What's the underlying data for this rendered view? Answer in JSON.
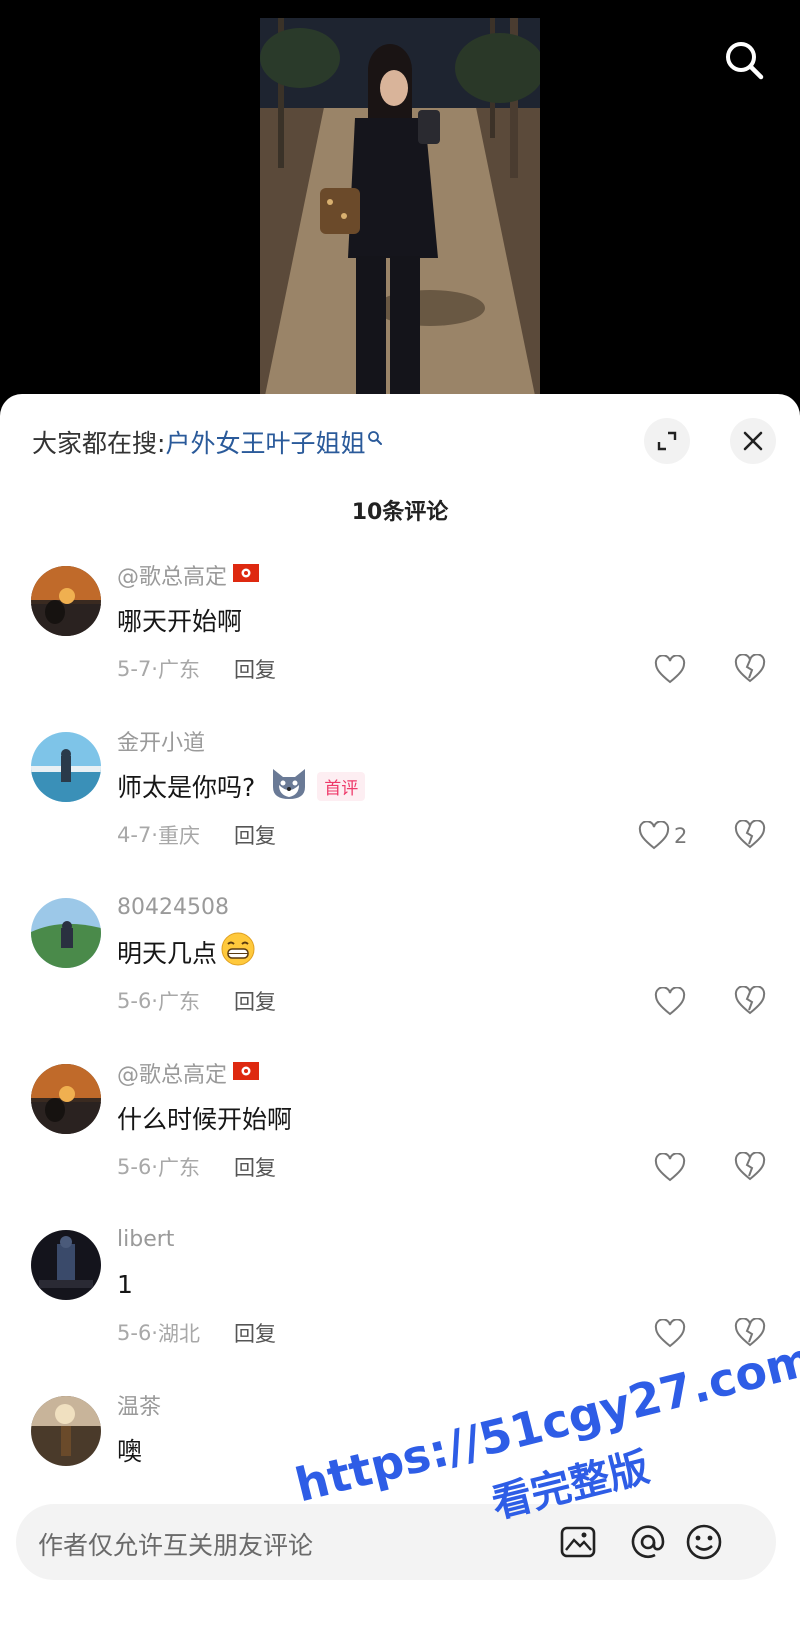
{
  "header": {
    "search_icon": "search-icon"
  },
  "sheet": {
    "suggest_prefix": "大家都在搜:",
    "suggest_query": "户外女王叶子姐姐",
    "expand_icon": "expand-icon",
    "close_icon": "close-icon",
    "comment_count_title": "10条评论"
  },
  "comments": [
    {
      "user": "@歌总高定",
      "text": "哪天开始啊",
      "date": "5-7·",
      "location": "广东",
      "reply": "回复",
      "likes": ""
    },
    {
      "user": "金开小道",
      "text": "师太是你吗?",
      "badge": "首评",
      "date": "4-7·",
      "location": "重庆",
      "reply": "回复",
      "likes": "2"
    },
    {
      "user": "80424508",
      "text": "明天几点",
      "date": "5-6·",
      "location": "广东",
      "reply": "回复",
      "likes": ""
    },
    {
      "user": "@歌总高定",
      "text": "什么时候开始啊",
      "date": "5-6·",
      "location": "广东",
      "reply": "回复",
      "likes": ""
    },
    {
      "user": "libert",
      "text": "1",
      "date": "5-6·",
      "location": "湖北",
      "reply": "回复",
      "likes": ""
    },
    {
      "user": "温茶",
      "text": "噢"
    }
  ],
  "input_bar": {
    "placeholder": "作者仅允许互关朋友评论",
    "icons": [
      "image-icon",
      "at-icon",
      "emoji-icon"
    ]
  },
  "watermark": {
    "line1": "https://51cgy27.com",
    "line2": "看完整版"
  },
  "colors": {
    "link": "#2a5a9a",
    "badge": "#ee3a6a",
    "watermark": "#2e5de6"
  }
}
